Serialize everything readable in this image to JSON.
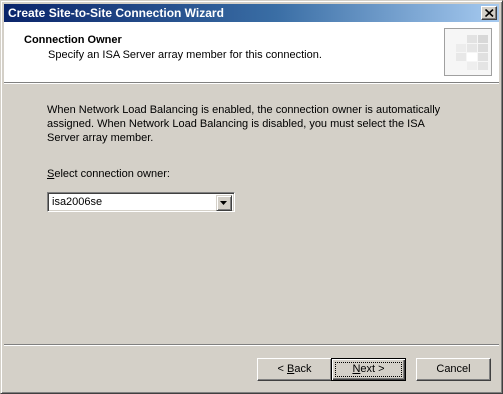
{
  "window": {
    "title": "Create Site-to-Site Connection Wizard"
  },
  "header": {
    "title": "Connection Owner",
    "subtitle": "Specify an ISA Server array member for this connection."
  },
  "body": {
    "info_text": "When Network Load Balancing is enabled, the connection owner is automatically assigned. When Network Load Balancing is disabled, you must select the ISA Server array member.",
    "select_label_mnemonic": "S",
    "select_label_rest": "elect connection owner:",
    "owner_select": {
      "value": "isa2006se"
    }
  },
  "buttons": {
    "back_prefix": "< ",
    "back_mnemonic": "B",
    "back_rest": "ack",
    "next_mnemonic": "N",
    "next_rest": "ext",
    "next_suffix": " >",
    "cancel": "Cancel"
  },
  "icons": {
    "close": "close-icon",
    "dropdown": "chevron-down-icon",
    "wizard": "wizard-logo-icon"
  },
  "colors": {
    "titlebar_start": "#0a246a",
    "titlebar_end": "#a6caf0",
    "dialog_background": "#d4d0c8",
    "header_background": "#ffffff"
  }
}
